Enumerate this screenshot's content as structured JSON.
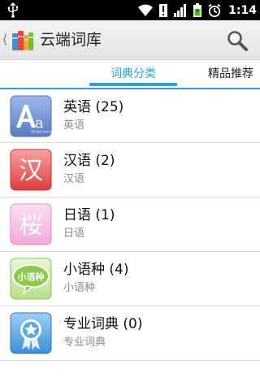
{
  "status_bar": {
    "time": "1:14",
    "icons": [
      "usb-icon",
      "wifi-icon",
      "notification-icon",
      "signal-icon",
      "battery-icon",
      "alarm-icon"
    ]
  },
  "action_bar": {
    "title": "云端词库",
    "icons": [
      "back-chevron-icon",
      "app-logo-books-icon",
      "search-icon"
    ]
  },
  "tabs": [
    {
      "label": "词典分类",
      "selected": true
    },
    {
      "label": "精品推荐",
      "selected": false
    }
  ],
  "categories": [
    {
      "title": "英语 (25)",
      "subtitle": "英语",
      "icon": "english-aa-icon",
      "icon_text": "Aa",
      "color": "#6f8fd0"
    },
    {
      "title": "汉语 (2)",
      "subtitle": "汉语",
      "icon": "chinese-han-icon",
      "icon_text": "汉",
      "color": "#e24a4a"
    },
    {
      "title": "日语 (1)",
      "subtitle": "日语",
      "icon": "japanese-sakura-icon",
      "icon_text": "桜",
      "color": "#f5b3e0"
    },
    {
      "title": "小语种 (4)",
      "subtitle": "小语种",
      "icon": "minor-language-bubble-icon",
      "icon_text": "小语种",
      "color": "#8dc94b"
    },
    {
      "title": "专业词典 (0)",
      "subtitle": "专业词典",
      "icon": "professional-star-badge-icon",
      "icon_text": "",
      "color": "#3d8ed6"
    }
  ],
  "colors": {
    "accent": "#33a0d8",
    "status_bar": "#000000",
    "action_bar": "#eeeeee",
    "divider": "#dcdcdc"
  }
}
